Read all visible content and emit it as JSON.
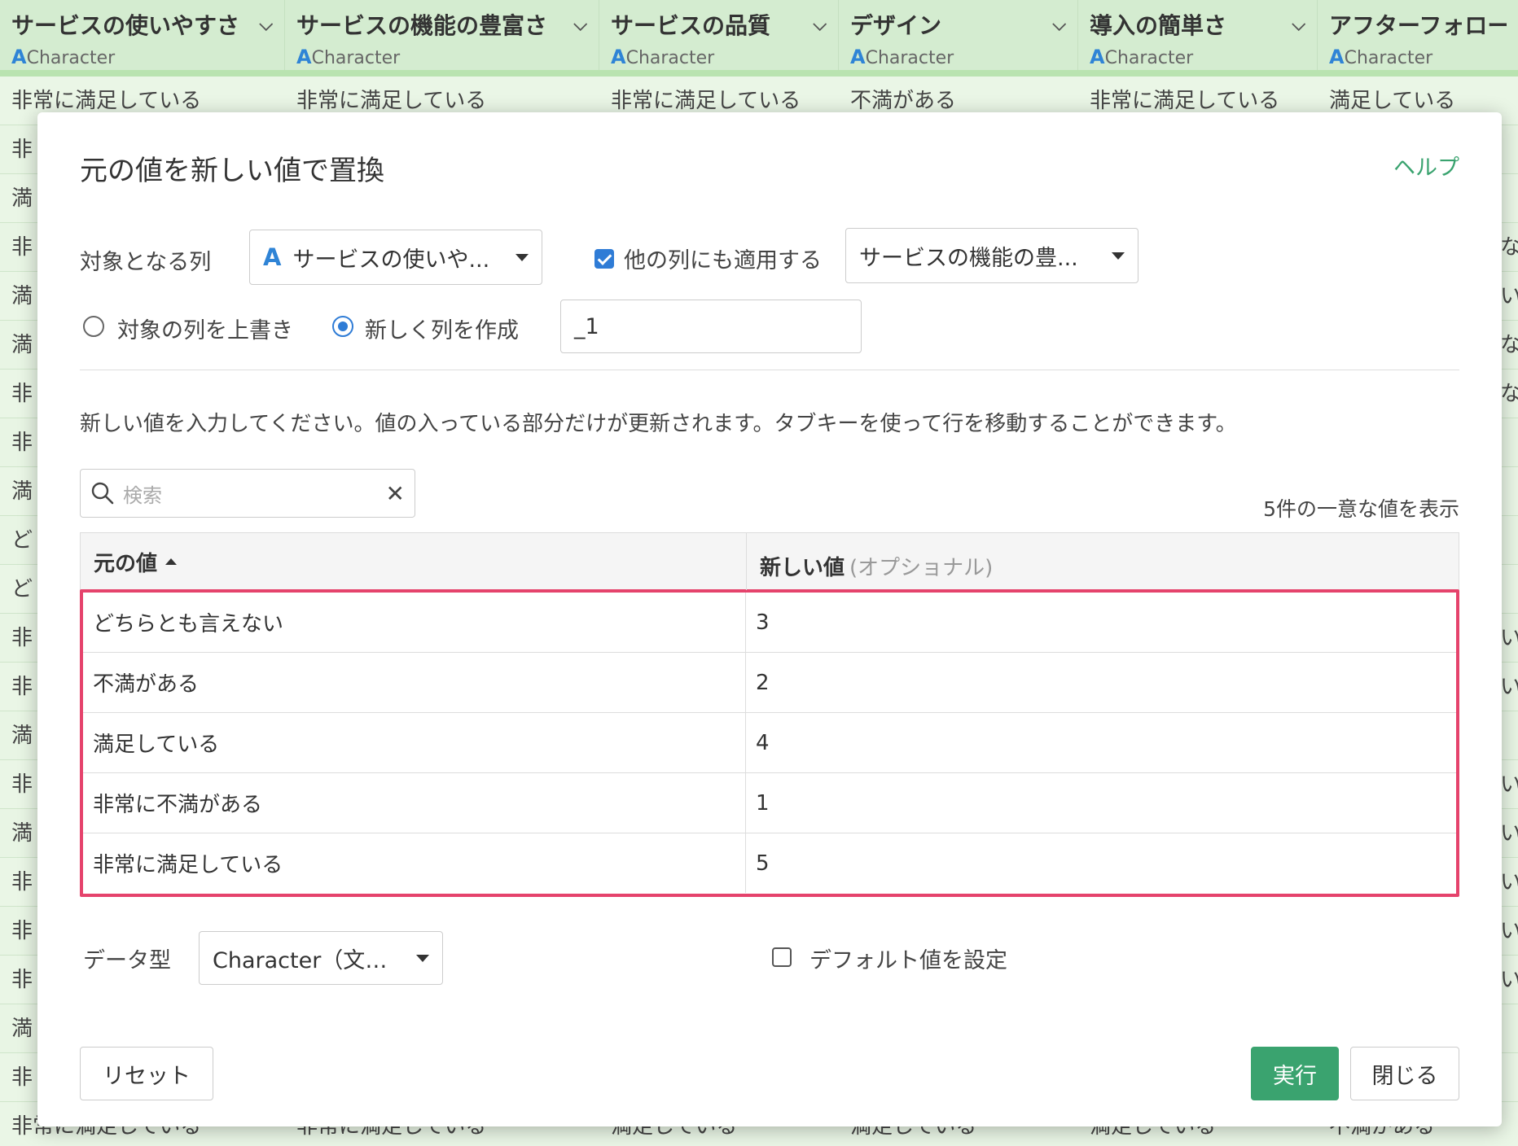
{
  "background": {
    "columns": [
      {
        "title": "サービスの使いやすさ",
        "type_label": "Character",
        "type_icon": "A"
      },
      {
        "title": "サービスの機能の豊富さ",
        "type_label": "Character",
        "type_icon": "A"
      },
      {
        "title": "サービスの品質",
        "type_label": "Character",
        "type_icon": "A"
      },
      {
        "title": "デザイン",
        "type_label": "Character",
        "type_icon": "A"
      },
      {
        "title": "導入の簡単さ",
        "type_label": "Character",
        "type_icon": "A"
      },
      {
        "title": "アフターフォロー",
        "type_label": "Character",
        "type_icon": "A"
      }
    ],
    "first_row": [
      "非常に満足している",
      "非常に満足している",
      "非常に満足している",
      "不満がある",
      "非常に満足している",
      "満足している"
    ],
    "left_stub": [
      "非",
      "満",
      "非",
      "満",
      "満",
      "非",
      "非",
      "満",
      "ど",
      "ど",
      "非",
      "非",
      "満",
      "非",
      "満",
      "非",
      "非",
      "非",
      "満",
      "非"
    ],
    "right_stub": [
      "",
      "",
      "な",
      "い",
      "な",
      "な",
      "",
      "",
      "",
      "",
      "い",
      "い",
      "",
      "い",
      "い",
      "い",
      "い",
      "い",
      "",
      ""
    ],
    "last_row": [
      "非常に満足している",
      "非常に満足している",
      "満足している",
      "満足している",
      "満足している",
      "不満がある"
    ]
  },
  "dialog": {
    "title": "元の値を新しい値で置換",
    "help": "ヘルプ",
    "target_label": "対象となる列",
    "target_icon": "A",
    "target_value": "サービスの使いや...",
    "apply_other_label": "他の列にも適用する",
    "apply_other_checked": true,
    "other_columns_value": "サービスの機能の豊...",
    "overwrite_label": "対象の列を上書き",
    "new_column_label": "新しく列を作成",
    "new_column_selected": true,
    "suffix_value": "_1",
    "description": "新しい値を入力してください。値の入っている部分だけが更新されます。タブキーを使って行を移動することができます。",
    "search_placeholder": "検索",
    "count_text": "5件の一意な値を表示",
    "table": {
      "col_original": "元の値",
      "col_new": "新しい値",
      "col_new_optional": "(オプショナル)",
      "rows": [
        {
          "original": "どちらとも言えない",
          "new": "3"
        },
        {
          "original": "不満がある",
          "new": "2"
        },
        {
          "original": "満足している",
          "new": "4"
        },
        {
          "original": "非常に不満がある",
          "new": "1"
        },
        {
          "original": "非常に満足している",
          "new": "5"
        }
      ]
    },
    "datatype_label": "データ型",
    "datatype_value": "Character（文字）",
    "default_label": "デフォルト値を設定",
    "default_checked": false,
    "reset_label": "リセット",
    "run_label": "実行",
    "close_label": "閉じる"
  },
  "colors": {
    "accent": "#3aa36f",
    "highlight": "#e5436c",
    "checkbox": "#2f7cd6"
  }
}
